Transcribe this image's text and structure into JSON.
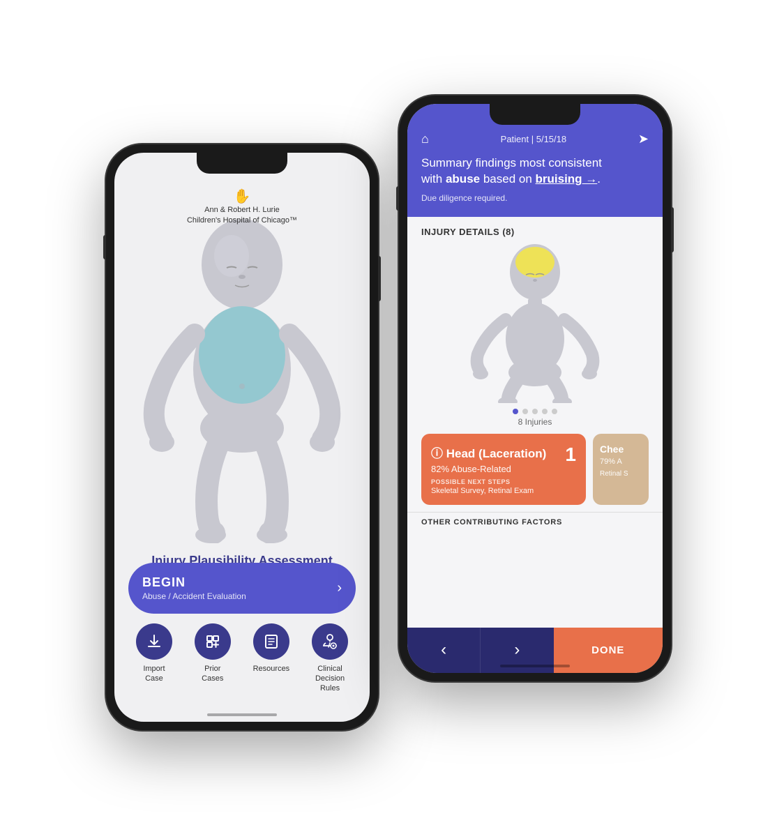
{
  "phones": {
    "left": {
      "hospital": {
        "name_line1": "Ann & Robert H. Lurie",
        "name_line2": "Children's Hospital of Chicago™",
        "logo_icon": "✋"
      },
      "main_title": "Injury Plausibility Assessment",
      "begin_button": {
        "label": "BEGIN",
        "sublabel": "Abuse / Accident Evaluation",
        "chevron": "›"
      },
      "bottom_icons": [
        {
          "icon": "⬇",
          "label": "Import\nCase"
        },
        {
          "icon": "+",
          "label": "Prior\nCases"
        },
        {
          "icon": "☰",
          "label": "Resources"
        },
        {
          "icon": "♡",
          "label": "Clinical\nDecision\nRules"
        }
      ]
    },
    "right": {
      "header": {
        "patient_date": "Patient | 5/15/18",
        "summary_line1": "Summary findings most consistent",
        "summary_line2": "with ",
        "summary_bold1": "abuse",
        "summary_line3": " based on ",
        "summary_bold2": "bruising →",
        "summary_end": ".",
        "due_diligence": "Due diligence required."
      },
      "injury_details": {
        "title": "INJURY DETAILS (8)"
      },
      "injuries_count": "8 Injuries",
      "injury_cards": [
        {
          "title": "Head (Laceration)",
          "info": "ⓘ",
          "percent": "82% Abuse-Related",
          "next_steps_label": "POSSIBLE NEXT STEPS",
          "next_steps": "Skeletal Survey, Retinal Exam",
          "number": "1"
        },
        {
          "title": "Chee",
          "percent": "79% A",
          "next_steps": "Retinal S"
        }
      ],
      "other_contributing": "OTHER CONTRIBUTING FACTORS",
      "nav": {
        "prev": "‹",
        "next": "›",
        "done": "DONE"
      }
    }
  },
  "colors": {
    "purple_dark": "#3a3a8c",
    "purple_medium": "#5555cc",
    "orange": "#e8704a",
    "tan": "#d4b896",
    "navy": "#2a2a6e"
  }
}
